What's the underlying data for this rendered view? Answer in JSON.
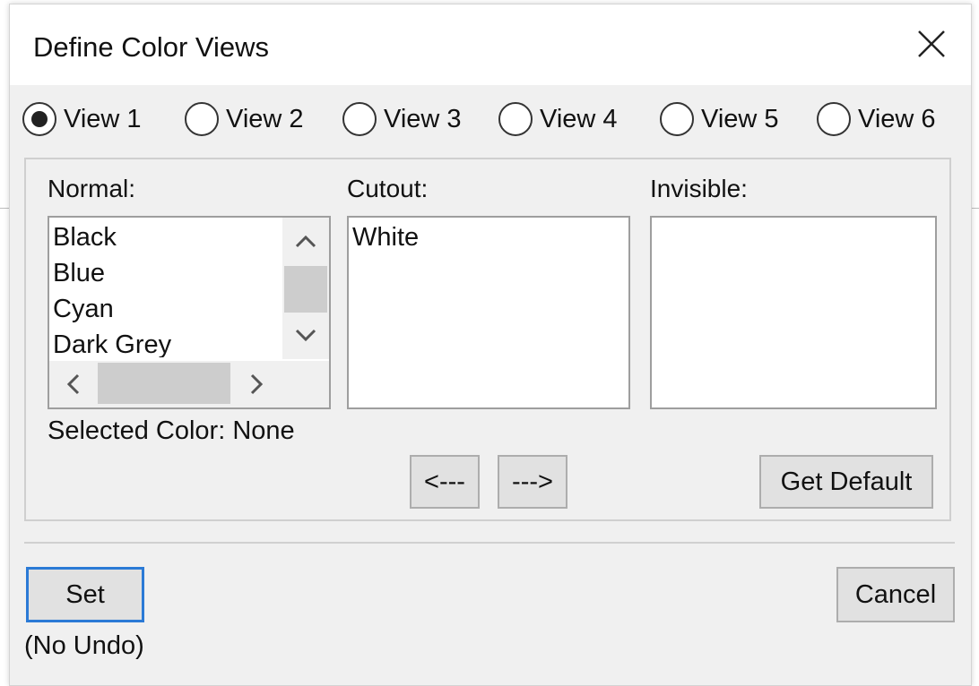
{
  "dialog": {
    "title": "Define Color Views",
    "close_icon": "close-x-icon"
  },
  "views": [
    {
      "label": "View 1",
      "selected": true
    },
    {
      "label": "View 2",
      "selected": false
    },
    {
      "label": "View 3",
      "selected": false
    },
    {
      "label": "View 4",
      "selected": false
    },
    {
      "label": "View 5",
      "selected": false
    },
    {
      "label": "View 6",
      "selected": false
    }
  ],
  "normal": {
    "label": "Normal:",
    "items": [
      "Black",
      "Blue",
      "Cyan",
      "Dark Grey"
    ]
  },
  "cutout": {
    "label": "Cutout:",
    "items": [
      "White"
    ]
  },
  "invisible": {
    "label": "Invisible:",
    "items": []
  },
  "selected_color": "Selected Color: None",
  "buttons": {
    "move_left": "<---",
    "move_right": "--->",
    "get_default": "Get Default",
    "set": "Set",
    "cancel": "Cancel"
  },
  "no_undo": "(No Undo)"
}
